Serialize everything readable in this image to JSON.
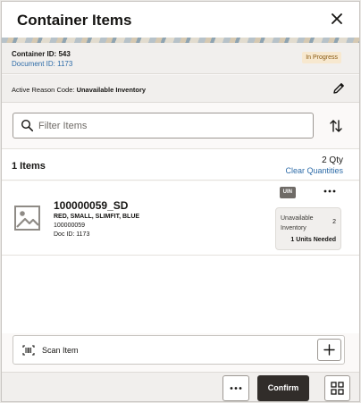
{
  "header": {
    "title": "Container Items"
  },
  "container": {
    "id_text": "Container ID: 543",
    "document_text": "Document ID: 1173",
    "status": "In Progress"
  },
  "reason": {
    "label": "Active Reason Code:",
    "value": "Unavailable Inventory"
  },
  "filter": {
    "placeholder": "Filter Items",
    "value": ""
  },
  "summary": {
    "count": "1 Items",
    "qty": "2 Qty",
    "clear_label": "Clear Quantities"
  },
  "items": [
    {
      "sku": "100000059_SD",
      "description": "RED, SMALL, SLIMFIT, BLUE",
      "number": "100000059",
      "doc": "Doc ID: 1173",
      "badge": "UIN",
      "reason_text": "Unavailable Inventory",
      "reason_count": "2",
      "units_needed": "1 Units Needed"
    }
  ],
  "scan": {
    "label": "Scan Item"
  },
  "footer": {
    "confirm_label": "Confirm"
  },
  "colors": {
    "accent_link": "#2e6ca8",
    "confirm_bg": "#312d2a",
    "status_bg": "#f7e8cf"
  }
}
